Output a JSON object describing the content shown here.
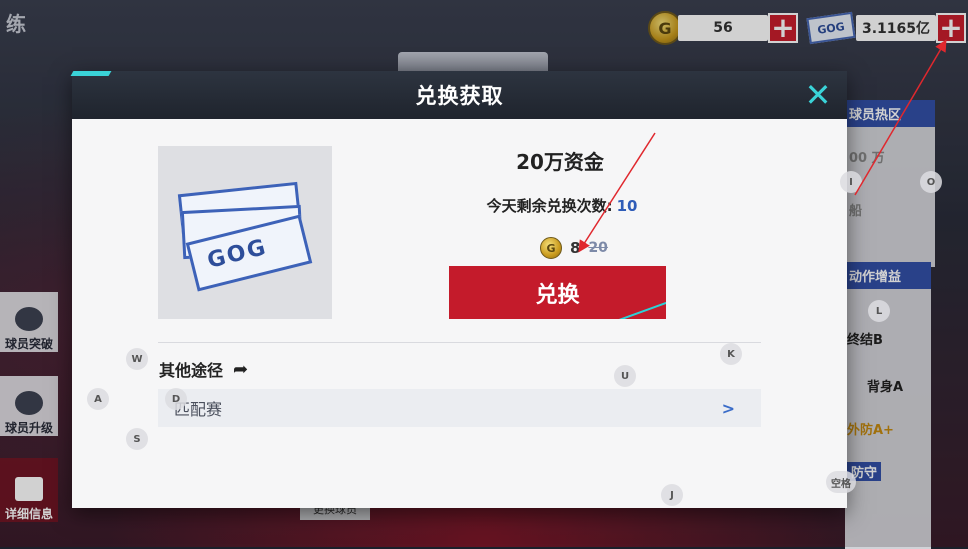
{
  "background": {
    "title": "练",
    "left_buttons": [
      "球员突破",
      "球员升级",
      "详细信息"
    ],
    "right_panel": {
      "header": "球员热区",
      "row1": "00 万",
      "row2": "船",
      "skill_header": "动作增益",
      "skill1": "终结B",
      "skill2": "背身A",
      "skill3": "外防A+",
      "skill4": "防守"
    },
    "bottom_hint": "更换球员"
  },
  "currency": {
    "coins": {
      "value": "56",
      "icon": "gold-coin-icon"
    },
    "cash": {
      "value": "3.1165亿",
      "icon": "gog-cash-icon",
      "label": "GOG"
    }
  },
  "modal": {
    "title": "兑换获取",
    "item_name": "20万资金",
    "remaining_label": "今天剩余兑换次数:",
    "remaining_count": "10",
    "price_now": "8",
    "price_old": "20",
    "exchange_button": "兑换",
    "other_routes_title": "其他途径",
    "routes": [
      {
        "label": "匹配赛",
        "arrow": ">"
      }
    ],
    "item_bill_text": "GOG"
  },
  "key_hints": [
    "W",
    "A",
    "D",
    "S",
    "U",
    "K",
    "L",
    "J",
    "O",
    "I"
  ],
  "key_hint_space": "空格",
  "accent_colors": {
    "red": "#c41b2b",
    "cyan": "#3ad3d8",
    "blue": "#2e5cb8"
  }
}
